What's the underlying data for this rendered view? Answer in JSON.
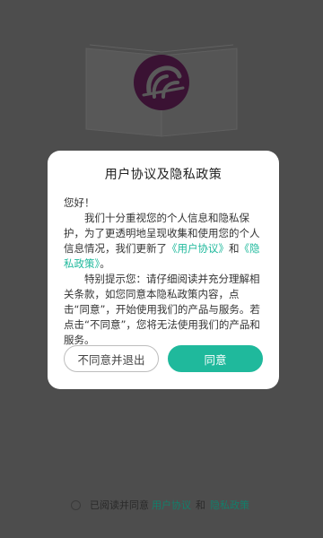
{
  "colors": {
    "overlay": "#4d4d4d",
    "accent": "#1fb99c",
    "logo": "#3a1233"
  },
  "logo": {
    "icon": "app-logo-icon"
  },
  "illustration": {
    "icon": "open-book-icon"
  },
  "dialog": {
    "title": "用户协议及隐私政策",
    "greeting": "您好！",
    "para1_prefix": "我们十分重视您的个人信息和隐私保护，为了更透明地呈现收集和使用您的个人信息情况，我们更新了",
    "user_agreement_link": "《用户协议》",
    "para1_and": "和",
    "privacy_policy_link": "《隐私政策》",
    "para1_suffix": "。",
    "para2": "特别提示您：请仔细阅读并充分理解相关条款，如您同意本隐私政策内容，点击“同意”，开始使用我们的产品与服务。若点击“不同意”，您将无法使用我们的产品和服务。",
    "decline_label": "不同意并退出",
    "agree_label": "同意"
  },
  "bottom": {
    "prefix": "已阅读并同意",
    "user_agreement": "用户协议",
    "and": "和",
    "privacy_policy": "隐私政策"
  }
}
